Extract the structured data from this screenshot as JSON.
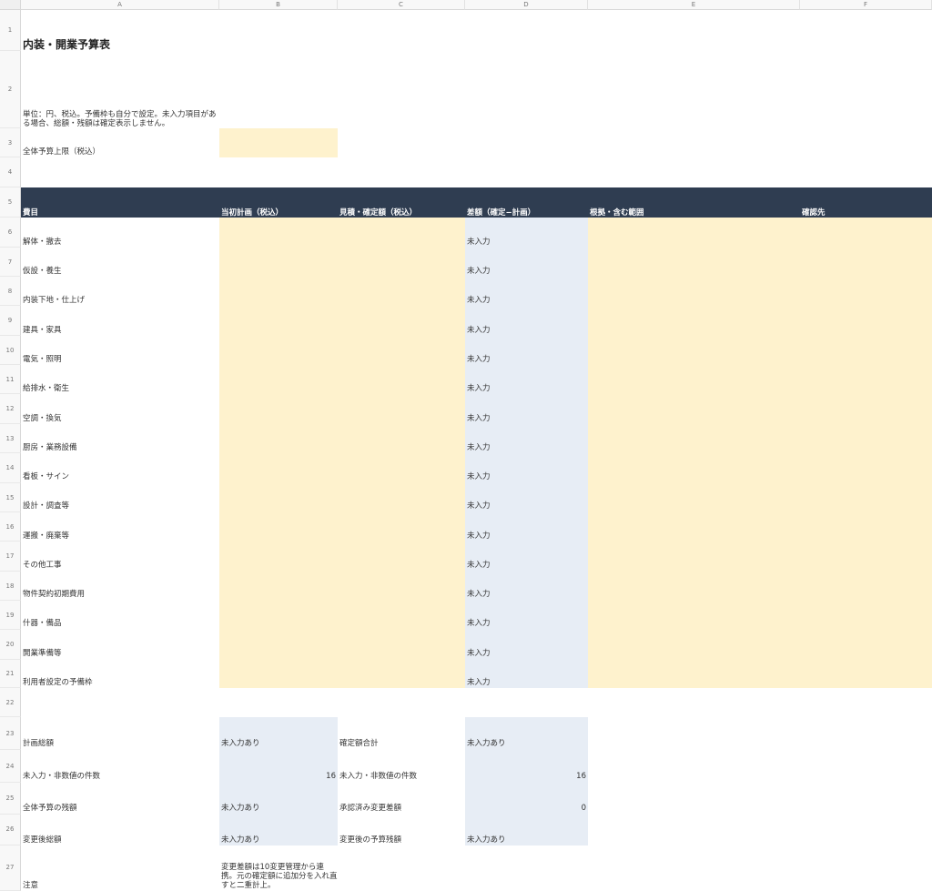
{
  "columns": [
    "A",
    "B",
    "C",
    "D",
    "E",
    "F"
  ],
  "rows": [
    "1",
    "2",
    "3",
    "4",
    "5",
    "6",
    "7",
    "8",
    "9",
    "10",
    "11",
    "12",
    "13",
    "14",
    "15",
    "16",
    "17",
    "18",
    "19",
    "20",
    "21",
    "22",
    "23",
    "24",
    "25",
    "26",
    "27"
  ],
  "title": "内装・開業予算表",
  "unit_note": "単位：円、税込。予備枠も自分で設定。未入力項目がある場合、総額・残額は確定表示しません。",
  "budget_limit_label": "全体予算上限（税込）",
  "header": {
    "item": "費目",
    "plan": "当初計画（税込）",
    "quote": "見積・確定額（税込）",
    "diff": "差額（確定−計画）",
    "basis": "根拠・含む範囲",
    "contact": "確認先"
  },
  "items": [
    {
      "name": "解体・撤去",
      "diff": "未入力"
    },
    {
      "name": "仮設・養生",
      "diff": "未入力"
    },
    {
      "name": "内装下地・仕上げ",
      "diff": "未入力"
    },
    {
      "name": "建具・家具",
      "diff": "未入力"
    },
    {
      "name": "電気・照明",
      "diff": "未入力"
    },
    {
      "name": "給排水・衛生",
      "diff": "未入力"
    },
    {
      "name": "空調・換気",
      "diff": "未入力"
    },
    {
      "name": "厨房・業務設備",
      "diff": "未入力"
    },
    {
      "name": "看板・サイン",
      "diff": "未入力"
    },
    {
      "name": "設計・調査等",
      "diff": "未入力"
    },
    {
      "name": "運搬・廃棄等",
      "diff": "未入力"
    },
    {
      "name": "その他工事",
      "diff": "未入力"
    },
    {
      "name": "物件契約初期費用",
      "diff": "未入力"
    },
    {
      "name": "什器・備品",
      "diff": "未入力"
    },
    {
      "name": "開業準備等",
      "diff": "未入力"
    },
    {
      "name": "利用者設定の予備枠",
      "diff": "未入力"
    }
  ],
  "summary": {
    "plan_total_label": "計画総額",
    "plan_total_value": "未入力あり",
    "confirmed_total_label": "確定額合計",
    "confirmed_total_value": "未入力あり",
    "missing_count_label_a": "未入力・非数値の件数",
    "missing_count_value_b": "16",
    "missing_count_label_c": "未入力・非数値の件数",
    "missing_count_value_d": "16",
    "remaining_label": "全体予算の残額",
    "remaining_value": "未入力あり",
    "approved_change_label": "承認済み変更差額",
    "approved_change_value": "0",
    "after_change_total_label": "変更後総額",
    "after_change_total_value": "未入力あり",
    "after_change_remaining_label": "変更後の予算残額",
    "after_change_remaining_value": "未入力あり"
  },
  "note_label": "注意",
  "note_text": "変更差額は10変更管理から連携。元の確定額に追加分を入れ直すと二重計上。",
  "colors": {
    "input_yellow": "#fef2cd",
    "calc_blue": "#e7edf5",
    "header_navy": "#2f3d51"
  }
}
